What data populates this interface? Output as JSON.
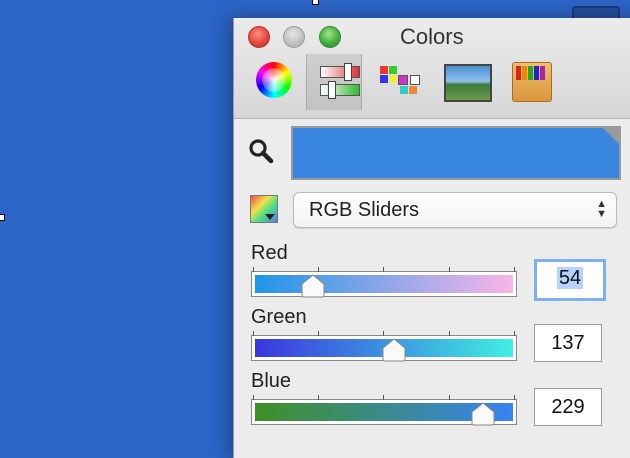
{
  "window": {
    "title": "Colors"
  },
  "toolbar": {
    "tabs": [
      {
        "name": "color-wheel",
        "icon": "color-wheel-icon"
      },
      {
        "name": "color-sliders",
        "icon": "sliders-icon",
        "active": true
      },
      {
        "name": "color-palettes",
        "icon": "palette-grid-icon"
      },
      {
        "name": "image-palettes",
        "icon": "image-icon"
      },
      {
        "name": "pencils",
        "icon": "crayons-icon"
      }
    ]
  },
  "current_color": "#3886e0",
  "mode_select": {
    "value": "RGB Sliders"
  },
  "channels": {
    "red": {
      "label": "Red",
      "value": "54"
    },
    "green": {
      "label": "Green",
      "value": "137"
    },
    "blue": {
      "label": "Blue",
      "value": "229"
    }
  },
  "colors": {
    "desktop": "#2c65c8",
    "red_gradient": [
      "#1e96e8",
      "#f9b5e8"
    ],
    "green_gradient": [
      "#3b35e0",
      "#3ef0e0"
    ],
    "blue_gradient": [
      "#3f9025",
      "#3884f3"
    ]
  }
}
